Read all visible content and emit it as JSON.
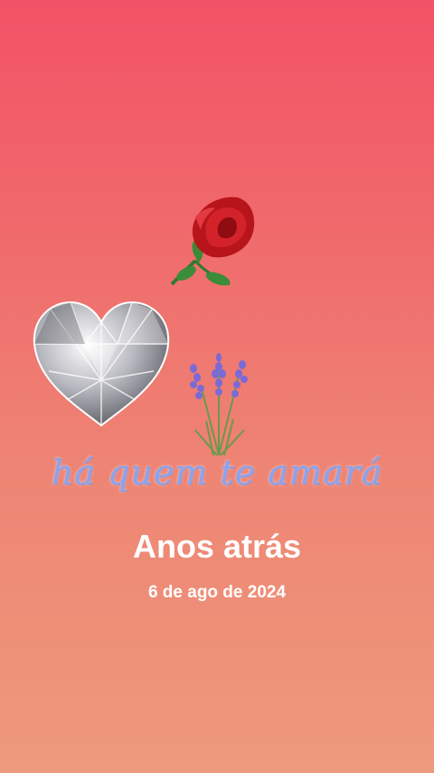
{
  "memory": {
    "script_text": "há quem te amará",
    "title": "Anos atrás",
    "date": "6 de ago de 2024"
  },
  "stickers": {
    "rose": "rose-sticker",
    "heart": "diamond-heart-sticker",
    "lavender": "lavender-sticker"
  },
  "colors": {
    "background_top": "#f25266",
    "background_bottom": "#ee9a7c",
    "script_text": "#8aa3ee",
    "title_text": "#ffffff"
  }
}
